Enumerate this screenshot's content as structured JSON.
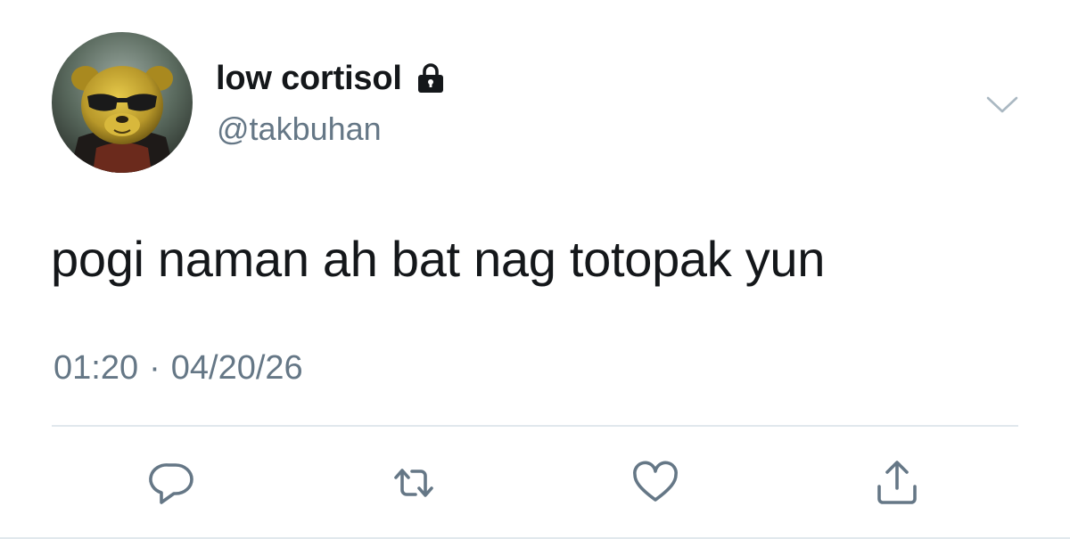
{
  "tweet": {
    "display_name": "low cortisol",
    "handle": "@takbuhan",
    "text": "pogi naman ah bat nag totopak yun",
    "time": "01:20",
    "separator": "·",
    "date": "04/20/26",
    "protected": true
  },
  "icons": {
    "lock": "lock-icon",
    "menu": "chevron-down-icon",
    "reply": "speech-bubble-icon",
    "retweet": "retweet-icon",
    "like": "heart-icon",
    "share": "share-upload-icon"
  },
  "colors": {
    "text_primary": "#14171a",
    "text_secondary": "#657786",
    "divider": "#e1e8ed",
    "icon": "#657786"
  }
}
